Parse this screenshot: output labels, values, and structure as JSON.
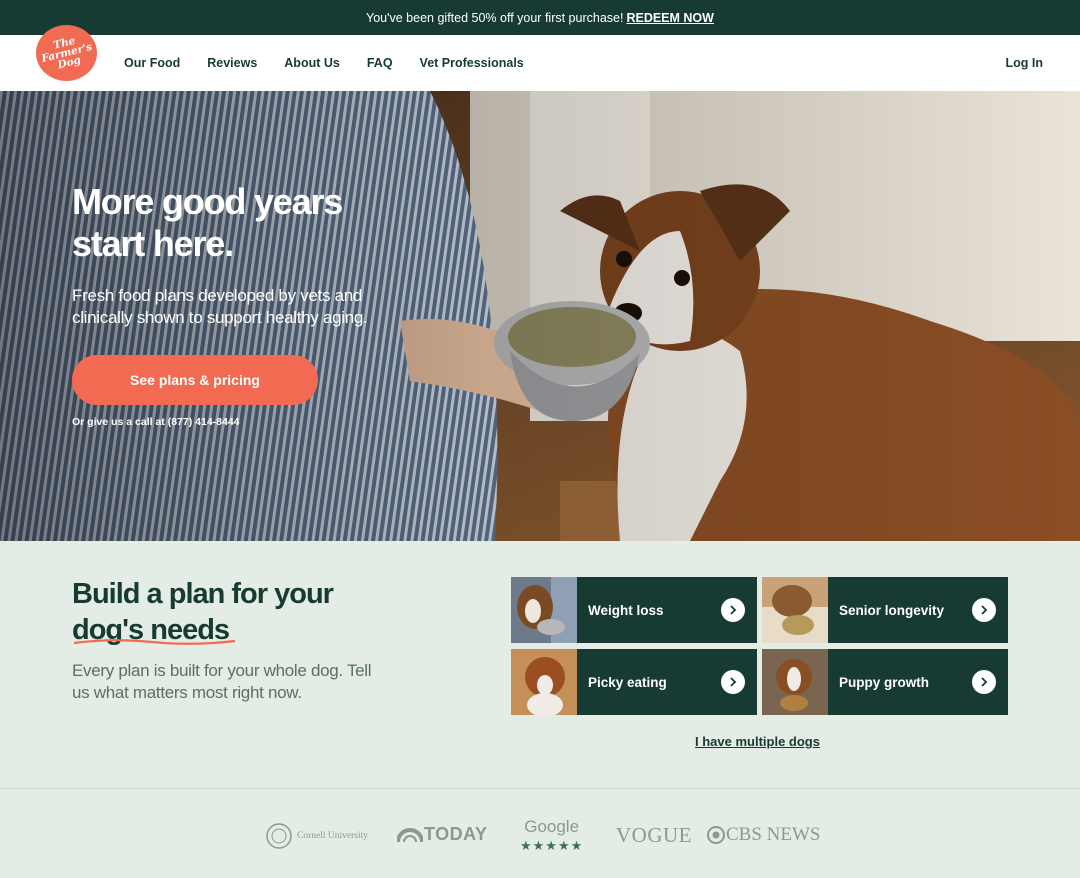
{
  "promo": {
    "text": "You've been gifted 50% off your first purchase!",
    "link": "REDEEM NOW"
  },
  "logo": {
    "text": "The Farmer's Dog"
  },
  "nav": {
    "items": [
      "Our Food",
      "Reviews",
      "About Us",
      "FAQ",
      "Vet Professionals"
    ],
    "login": "Log In"
  },
  "hero": {
    "title": "More good years start here.",
    "subtitle": "Fresh food plans developed by vets and clinically shown to support healthy aging.",
    "cta": "See plans & pricing",
    "call": "Or give us a call at (877) 414-8444"
  },
  "plan": {
    "title_line1": "Build a plan for your",
    "title_line2": "dog's needs",
    "subtitle": "Every plan is built for your whole dog. Tell us what matters most right now.",
    "tiles": [
      {
        "label": "Weight loss"
      },
      {
        "label": "Senior longevity"
      },
      {
        "label": "Picky eating"
      },
      {
        "label": "Puppy growth"
      }
    ],
    "multiple": "I have multiple dogs"
  },
  "press": {
    "cornell": "Cornell University",
    "today": "TODAY",
    "google": "Google",
    "vogue": "VOGUE",
    "cbs": "CBS NEWS"
  },
  "colors": {
    "brand_green": "#173b33",
    "accent": "#f26a51",
    "background": "#e3ede6"
  }
}
